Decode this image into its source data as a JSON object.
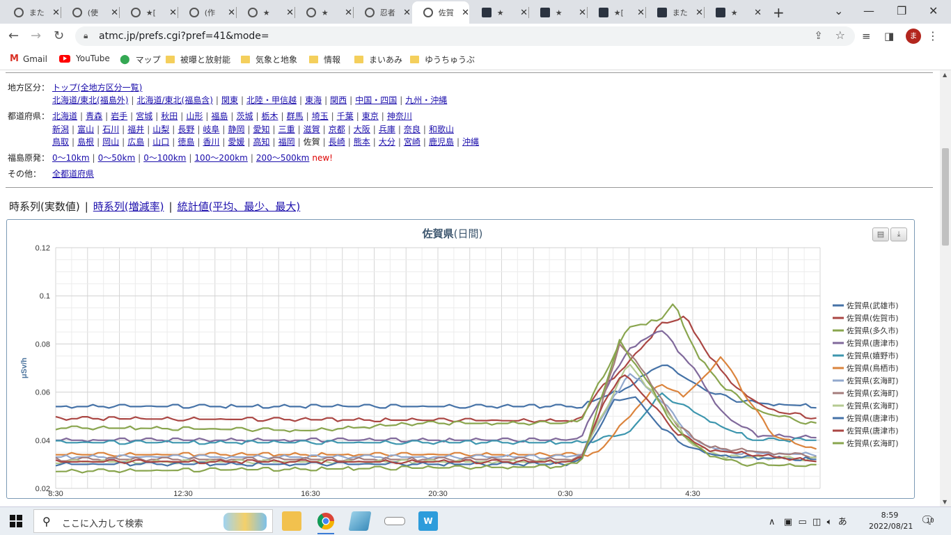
{
  "browser": {
    "tabs": [
      {
        "title": "また",
        "icon": "globe-icon"
      },
      {
        "title": "(使",
        "icon": "globe-icon"
      },
      {
        "title": "★[",
        "icon": "globe-icon"
      },
      {
        "title": "(作",
        "icon": "globe-icon"
      },
      {
        "title": "★",
        "icon": "globe-icon"
      },
      {
        "title": "★",
        "icon": "globe-icon"
      },
      {
        "title": "忍者",
        "icon": "globe-icon"
      },
      {
        "title": "佐賀",
        "icon": "globe-icon",
        "active": true
      },
      {
        "title": "★",
        "icon": "book-icon"
      },
      {
        "title": "★",
        "icon": "book-icon"
      },
      {
        "title": "★[",
        "icon": "book-icon"
      },
      {
        "title": "また",
        "icon": "book-icon"
      },
      {
        "title": "★",
        "icon": "book-icon"
      }
    ],
    "url": "atmc.jp/prefs.cgi?pref=41&mode=",
    "avatar_letter": "ま",
    "bookmarks": [
      {
        "label": "Gmail",
        "icon": "gmail-icon"
      },
      {
        "label": "YouTube",
        "icon": "youtube-icon"
      },
      {
        "label": "マップ",
        "icon": "maps-icon"
      },
      {
        "label": "被曝と放射能",
        "icon": "folder-icon"
      },
      {
        "label": "気象と地象",
        "icon": "folder-icon"
      },
      {
        "label": "情報",
        "icon": "folder-icon"
      },
      {
        "label": "まいあみ",
        "icon": "folder-icon"
      },
      {
        "label": "ゆうちゅうぶ",
        "icon": "folder-icon"
      }
    ]
  },
  "nav": {
    "region_label": "地方区分：",
    "region_top": "トップ(全地方区分一覧)",
    "regions": [
      "北海道/東北(福島外)",
      "北海道/東北(福島含)",
      "関東",
      "北陸・甲信越",
      "東海",
      "関西",
      "中国・四国",
      "九州・沖縄"
    ],
    "pref_label": "都道府県：",
    "prefs_row1": [
      "北海道",
      "青森",
      "岩手",
      "宮城",
      "秋田",
      "山形",
      "福島",
      "茨城",
      "栃木",
      "群馬",
      "埼玉",
      "千葉",
      "東京",
      "神奈川"
    ],
    "prefs_row2": [
      "新潟",
      "富山",
      "石川",
      "福井",
      "山梨",
      "長野",
      "岐阜",
      "静岡",
      "愛知",
      "三重",
      "滋賀",
      "京都",
      "大阪",
      "兵庫",
      "奈良",
      "和歌山"
    ],
    "prefs_row3": [
      "鳥取",
      "島根",
      "岡山",
      "広島",
      "山口",
      "徳島",
      "香川",
      "愛媛",
      "高知",
      "福岡",
      "佐賀",
      "長崎",
      "熊本",
      "大分",
      "宮崎",
      "鹿児島",
      "沖縄"
    ],
    "current_pref": "佐賀",
    "fukushima_label": "福島原発：",
    "fukushima_links": [
      "0〜10km",
      "0〜50km",
      "0〜100km",
      "100〜200km",
      "200〜500km"
    ],
    "new_tag": "new!",
    "other_label": "その他：",
    "other_link": "全都道府県"
  },
  "view_tabs": {
    "current": "時系列(実数値)",
    "link1": "時系列(増減率)",
    "link2": "統計値(平均、最少、最大)",
    "separator": "|"
  },
  "chart_data": {
    "type": "line",
    "title": "佐賀県",
    "subtitle": "(日間)",
    "ylabel": "μSv/h",
    "ylim": [
      0.02,
      0.12
    ],
    "yticks": [
      "0.02",
      "0.04",
      "0.06",
      "0.08",
      "0.1",
      "0.12"
    ],
    "xlim": [
      8.5,
      32.5
    ],
    "xticks": [
      {
        "at": 8.5,
        "label": "8:30"
      },
      {
        "at": 12.5,
        "label": "12:30"
      },
      {
        "at": 16.5,
        "label": "16:30"
      },
      {
        "at": 20.5,
        "label": "20:30"
      },
      {
        "at": 24.5,
        "label": "0:30"
      },
      {
        "at": 28.5,
        "label": "4:30"
      }
    ],
    "legend_position": "right",
    "grid": true,
    "series": [
      {
        "name": "佐賀県(武雄市)",
        "color": "#4572a7",
        "points": [
          [
            8.5,
            0.054
          ],
          [
            24.5,
            0.054
          ],
          [
            25.0,
            0.054
          ],
          [
            25.5,
            0.057
          ],
          [
            26.5,
            0.062
          ],
          [
            27.5,
            0.072
          ],
          [
            28.0,
            0.068
          ],
          [
            29.0,
            0.06
          ],
          [
            30.0,
            0.056
          ],
          [
            31.0,
            0.055
          ],
          [
            32.5,
            0.054
          ]
        ]
      },
      {
        "name": "佐賀県(佐賀市)",
        "color": "#aa4643",
        "points": [
          [
            8.5,
            0.049
          ],
          [
            24.5,
            0.048
          ],
          [
            25.0,
            0.049
          ],
          [
            25.5,
            0.06
          ],
          [
            26.5,
            0.072
          ],
          [
            27.5,
            0.088
          ],
          [
            28.3,
            0.091
          ],
          [
            29.0,
            0.075
          ],
          [
            30.0,
            0.06
          ],
          [
            31.0,
            0.052
          ],
          [
            32.5,
            0.049
          ]
        ]
      },
      {
        "name": "佐賀県(多久市)",
        "color": "#89a54e",
        "points": [
          [
            8.5,
            0.045
          ],
          [
            10.5,
            0.045
          ],
          [
            11.0,
            0.045
          ],
          [
            16.5,
            0.044
          ],
          [
            20.0,
            0.047
          ],
          [
            24.5,
            0.047
          ],
          [
            25.0,
            0.048
          ],
          [
            25.5,
            0.062
          ],
          [
            26.5,
            0.087
          ],
          [
            27.5,
            0.09
          ],
          [
            27.9,
            0.097
          ],
          [
            28.7,
            0.074
          ],
          [
            29.5,
            0.062
          ],
          [
            30.5,
            0.052
          ],
          [
            32.5,
            0.046
          ]
        ]
      },
      {
        "name": "佐賀県(唐津市)",
        "color": "#80699b",
        "points": [
          [
            8.5,
            0.04
          ],
          [
            24.5,
            0.04
          ],
          [
            25.0,
            0.041
          ],
          [
            25.5,
            0.055
          ],
          [
            26.5,
            0.078
          ],
          [
            27.5,
            0.086
          ],
          [
            28.5,
            0.07
          ],
          [
            29.5,
            0.05
          ],
          [
            30.5,
            0.042
          ],
          [
            32.5,
            0.041
          ]
        ]
      },
      {
        "name": "佐賀県(嬉野市)",
        "color": "#3d96ae",
        "points": [
          [
            8.5,
            0.039
          ],
          [
            24.5,
            0.039
          ],
          [
            25.0,
            0.039
          ],
          [
            25.5,
            0.04
          ],
          [
            26.5,
            0.043
          ],
          [
            27.5,
            0.059
          ],
          [
            28.5,
            0.052
          ],
          [
            29.5,
            0.045
          ],
          [
            30.5,
            0.04
          ],
          [
            32.5,
            0.04
          ]
        ]
      },
      {
        "name": "佐賀県(鳥栖市)",
        "color": "#db843d",
        "points": [
          [
            8.5,
            0.034
          ],
          [
            24.5,
            0.034
          ],
          [
            25.0,
            0.034
          ],
          [
            25.5,
            0.034
          ],
          [
            26.5,
            0.05
          ],
          [
            27.5,
            0.064
          ],
          [
            28.2,
            0.058
          ],
          [
            29.0,
            0.068
          ],
          [
            29.4,
            0.075
          ],
          [
            30.0,
            0.062
          ],
          [
            31.0,
            0.042
          ],
          [
            32.5,
            0.035
          ]
        ]
      },
      {
        "name": "佐賀県(玄海町)",
        "color": "#92a8cd",
        "points": [
          [
            8.5,
            0.033
          ],
          [
            24.5,
            0.033
          ],
          [
            25.0,
            0.034
          ],
          [
            25.5,
            0.046
          ],
          [
            26.5,
            0.068
          ],
          [
            27.5,
            0.057
          ],
          [
            28.5,
            0.04
          ],
          [
            29.5,
            0.035
          ],
          [
            32.5,
            0.034
          ]
        ]
      },
      {
        "name": "佐賀県(玄海町)",
        "color": "#a47d7c",
        "points": [
          [
            8.5,
            0.032
          ],
          [
            24.5,
            0.032
          ],
          [
            25.0,
            0.033
          ],
          [
            25.5,
            0.048
          ],
          [
            26.2,
            0.08
          ],
          [
            27.0,
            0.068
          ],
          [
            28.0,
            0.046
          ],
          [
            29.0,
            0.037
          ],
          [
            32.5,
            0.033
          ]
        ]
      },
      {
        "name": "佐賀県(玄海町)",
        "color": "#b5ca92",
        "points": [
          [
            8.5,
            0.031
          ],
          [
            24.5,
            0.031
          ],
          [
            25.0,
            0.032
          ],
          [
            25.5,
            0.046
          ],
          [
            26.5,
            0.072
          ],
          [
            27.5,
            0.055
          ],
          [
            28.5,
            0.038
          ],
          [
            29.5,
            0.033
          ],
          [
            32.5,
            0.032
          ]
        ]
      },
      {
        "name": "佐賀県(唐津市)",
        "color": "#4572a7",
        "points": [
          [
            8.5,
            0.03
          ],
          [
            24.5,
            0.03
          ],
          [
            25.0,
            0.032
          ],
          [
            25.5,
            0.044
          ],
          [
            26.0,
            0.056
          ],
          [
            26.7,
            0.058
          ],
          [
            27.5,
            0.045
          ],
          [
            28.5,
            0.036
          ],
          [
            29.5,
            0.033
          ],
          [
            32.5,
            0.032
          ]
        ]
      },
      {
        "name": "佐賀県(唐津市)",
        "color": "#aa4643",
        "points": [
          [
            8.5,
            0.031
          ],
          [
            24.5,
            0.031
          ],
          [
            25.0,
            0.032
          ],
          [
            25.5,
            0.05
          ],
          [
            26.3,
            0.068
          ],
          [
            27.0,
            0.058
          ],
          [
            28.0,
            0.043
          ],
          [
            29.0,
            0.036
          ],
          [
            32.5,
            0.031
          ]
        ]
      },
      {
        "name": "佐賀県(玄海町)",
        "color": "#89a54e",
        "points": [
          [
            8.5,
            0.027
          ],
          [
            24.5,
            0.029
          ],
          [
            25.0,
            0.031
          ],
          [
            25.5,
            0.052
          ],
          [
            26.2,
            0.081
          ],
          [
            27.0,
            0.066
          ],
          [
            28.0,
            0.044
          ],
          [
            29.0,
            0.034
          ],
          [
            30.0,
            0.03
          ],
          [
            32.5,
            0.029
          ]
        ]
      }
    ]
  },
  "chart_buttons": {
    "print": "print-icon",
    "download": "download-icon"
  },
  "taskbar": {
    "search_placeholder": "ここに入力して検索",
    "time": "8:59",
    "date": "2022/08/21",
    "ime": "あ",
    "notifications": "10"
  }
}
